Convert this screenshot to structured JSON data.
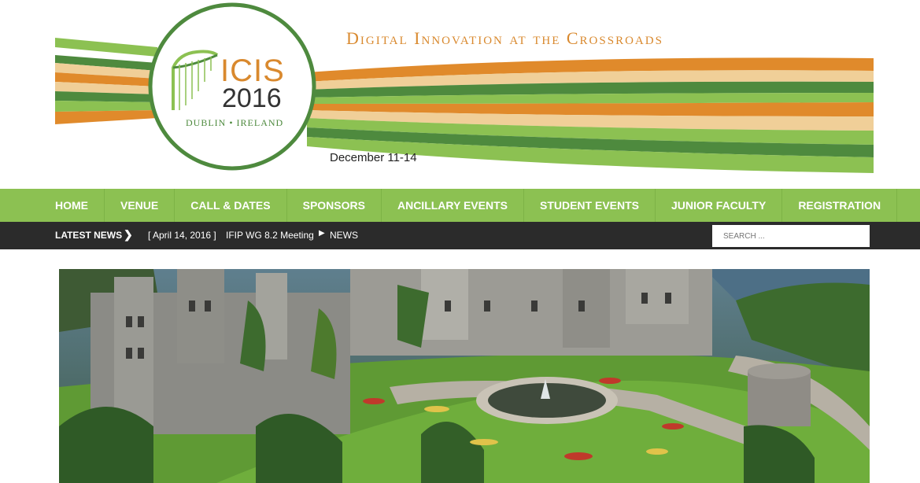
{
  "header": {
    "logo": {
      "name": "ICIS",
      "year": "2016",
      "city": "DUBLIN • IRELAND"
    },
    "tagline": "Digital Innovation at the Crossroads",
    "dates": "December 11-14"
  },
  "nav": {
    "items": [
      {
        "label": "HOME"
      },
      {
        "label": "VENUE"
      },
      {
        "label": "CALL & DATES"
      },
      {
        "label": "SPONSORS"
      },
      {
        "label": "ANCILLARY EVENTS"
      },
      {
        "label": "STUDENT EVENTS"
      },
      {
        "label": "JUNIOR FACULTY"
      },
      {
        "label": "REGISTRATION"
      }
    ]
  },
  "news": {
    "label": "LATEST NEWS",
    "date": "[ April 14, 2016 ]",
    "title": "IFIP WG 8.2 Meeting",
    "category": "NEWS"
  },
  "search": {
    "placeholder": "SEARCH ..."
  },
  "colors": {
    "green": "#8cc152",
    "dark_green": "#4e8a3e",
    "orange": "#e08a2b",
    "tan": "#f0cf98",
    "news_bar": "#2b2b2b"
  },
  "icons": {
    "news_chevron": "chevron-right-icon",
    "news_arrow": "caret-right-icon",
    "logo_harp": "harp-icon"
  }
}
